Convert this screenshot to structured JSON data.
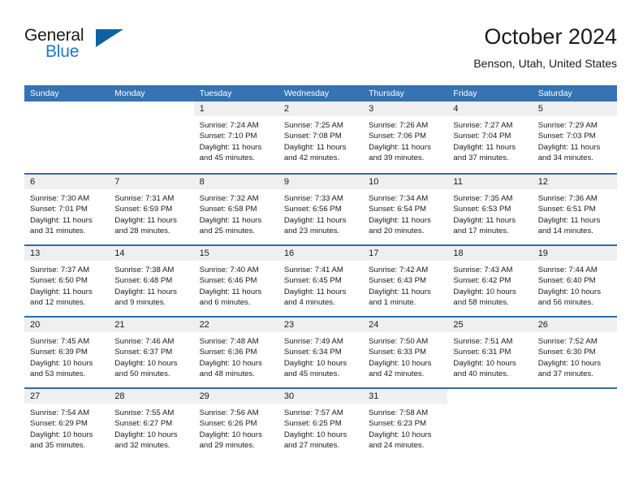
{
  "logo": {
    "word_one": "General",
    "word_two": "Blue",
    "triangle_icon": "triangle-icon"
  },
  "header": {
    "title": "October 2024",
    "subtitle": "Benson, Utah, United States"
  },
  "colors": {
    "header_blue": "#3573b3",
    "row_divider_blue": "#2e6da8",
    "day_band_gray": "#efefef",
    "logo_blue": "#2079c4",
    "text": "#1a1a1a"
  },
  "weekdays": [
    "Sunday",
    "Monday",
    "Tuesday",
    "Wednesday",
    "Thursday",
    "Friday",
    "Saturday"
  ],
  "weeks": [
    [
      {
        "day": "",
        "lines": []
      },
      {
        "day": "",
        "lines": []
      },
      {
        "day": "1",
        "lines": [
          "Sunrise: 7:24 AM",
          "Sunset: 7:10 PM",
          "Daylight: 11 hours",
          "and 45 minutes."
        ]
      },
      {
        "day": "2",
        "lines": [
          "Sunrise: 7:25 AM",
          "Sunset: 7:08 PM",
          "Daylight: 11 hours",
          "and 42 minutes."
        ]
      },
      {
        "day": "3",
        "lines": [
          "Sunrise: 7:26 AM",
          "Sunset: 7:06 PM",
          "Daylight: 11 hours",
          "and 39 minutes."
        ]
      },
      {
        "day": "4",
        "lines": [
          "Sunrise: 7:27 AM",
          "Sunset: 7:04 PM",
          "Daylight: 11 hours",
          "and 37 minutes."
        ]
      },
      {
        "day": "5",
        "lines": [
          "Sunrise: 7:29 AM",
          "Sunset: 7:03 PM",
          "Daylight: 11 hours",
          "and 34 minutes."
        ]
      }
    ],
    [
      {
        "day": "6",
        "lines": [
          "Sunrise: 7:30 AM",
          "Sunset: 7:01 PM",
          "Daylight: 11 hours",
          "and 31 minutes."
        ]
      },
      {
        "day": "7",
        "lines": [
          "Sunrise: 7:31 AM",
          "Sunset: 6:59 PM",
          "Daylight: 11 hours",
          "and 28 minutes."
        ]
      },
      {
        "day": "8",
        "lines": [
          "Sunrise: 7:32 AM",
          "Sunset: 6:58 PM",
          "Daylight: 11 hours",
          "and 25 minutes."
        ]
      },
      {
        "day": "9",
        "lines": [
          "Sunrise: 7:33 AM",
          "Sunset: 6:56 PM",
          "Daylight: 11 hours",
          "and 23 minutes."
        ]
      },
      {
        "day": "10",
        "lines": [
          "Sunrise: 7:34 AM",
          "Sunset: 6:54 PM",
          "Daylight: 11 hours",
          "and 20 minutes."
        ]
      },
      {
        "day": "11",
        "lines": [
          "Sunrise: 7:35 AM",
          "Sunset: 6:53 PM",
          "Daylight: 11 hours",
          "and 17 minutes."
        ]
      },
      {
        "day": "12",
        "lines": [
          "Sunrise: 7:36 AM",
          "Sunset: 6:51 PM",
          "Daylight: 11 hours",
          "and 14 minutes."
        ]
      }
    ],
    [
      {
        "day": "13",
        "lines": [
          "Sunrise: 7:37 AM",
          "Sunset: 6:50 PM",
          "Daylight: 11 hours",
          "and 12 minutes."
        ]
      },
      {
        "day": "14",
        "lines": [
          "Sunrise: 7:38 AM",
          "Sunset: 6:48 PM",
          "Daylight: 11 hours",
          "and 9 minutes."
        ]
      },
      {
        "day": "15",
        "lines": [
          "Sunrise: 7:40 AM",
          "Sunset: 6:46 PM",
          "Daylight: 11 hours",
          "and 6 minutes."
        ]
      },
      {
        "day": "16",
        "lines": [
          "Sunrise: 7:41 AM",
          "Sunset: 6:45 PM",
          "Daylight: 11 hours",
          "and 4 minutes."
        ]
      },
      {
        "day": "17",
        "lines": [
          "Sunrise: 7:42 AM",
          "Sunset: 6:43 PM",
          "Daylight: 11 hours",
          "and 1 minute."
        ]
      },
      {
        "day": "18",
        "lines": [
          "Sunrise: 7:43 AM",
          "Sunset: 6:42 PM",
          "Daylight: 10 hours",
          "and 58 minutes."
        ]
      },
      {
        "day": "19",
        "lines": [
          "Sunrise: 7:44 AM",
          "Sunset: 6:40 PM",
          "Daylight: 10 hours",
          "and 56 minutes."
        ]
      }
    ],
    [
      {
        "day": "20",
        "lines": [
          "Sunrise: 7:45 AM",
          "Sunset: 6:39 PM",
          "Daylight: 10 hours",
          "and 53 minutes."
        ]
      },
      {
        "day": "21",
        "lines": [
          "Sunrise: 7:46 AM",
          "Sunset: 6:37 PM",
          "Daylight: 10 hours",
          "and 50 minutes."
        ]
      },
      {
        "day": "22",
        "lines": [
          "Sunrise: 7:48 AM",
          "Sunset: 6:36 PM",
          "Daylight: 10 hours",
          "and 48 minutes."
        ]
      },
      {
        "day": "23",
        "lines": [
          "Sunrise: 7:49 AM",
          "Sunset: 6:34 PM",
          "Daylight: 10 hours",
          "and 45 minutes."
        ]
      },
      {
        "day": "24",
        "lines": [
          "Sunrise: 7:50 AM",
          "Sunset: 6:33 PM",
          "Daylight: 10 hours",
          "and 42 minutes."
        ]
      },
      {
        "day": "25",
        "lines": [
          "Sunrise: 7:51 AM",
          "Sunset: 6:31 PM",
          "Daylight: 10 hours",
          "and 40 minutes."
        ]
      },
      {
        "day": "26",
        "lines": [
          "Sunrise: 7:52 AM",
          "Sunset: 6:30 PM",
          "Daylight: 10 hours",
          "and 37 minutes."
        ]
      }
    ],
    [
      {
        "day": "27",
        "lines": [
          "Sunrise: 7:54 AM",
          "Sunset: 6:29 PM",
          "Daylight: 10 hours",
          "and 35 minutes."
        ]
      },
      {
        "day": "28",
        "lines": [
          "Sunrise: 7:55 AM",
          "Sunset: 6:27 PM",
          "Daylight: 10 hours",
          "and 32 minutes."
        ]
      },
      {
        "day": "29",
        "lines": [
          "Sunrise: 7:56 AM",
          "Sunset: 6:26 PM",
          "Daylight: 10 hours",
          "and 29 minutes."
        ]
      },
      {
        "day": "30",
        "lines": [
          "Sunrise: 7:57 AM",
          "Sunset: 6:25 PM",
          "Daylight: 10 hours",
          "and 27 minutes."
        ]
      },
      {
        "day": "31",
        "lines": [
          "Sunrise: 7:58 AM",
          "Sunset: 6:23 PM",
          "Daylight: 10 hours",
          "and 24 minutes."
        ]
      },
      {
        "day": "",
        "lines": []
      },
      {
        "day": "",
        "lines": []
      }
    ]
  ]
}
